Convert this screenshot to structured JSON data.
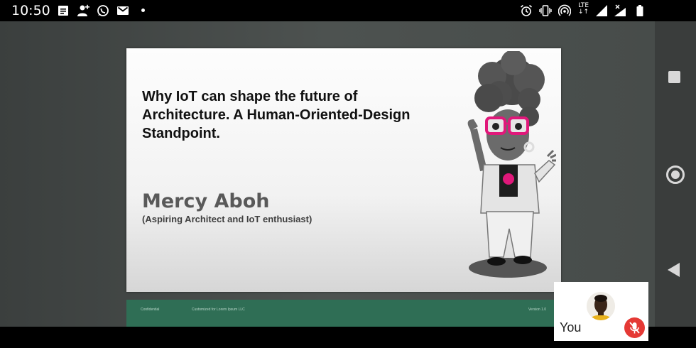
{
  "status_bar": {
    "time": "10:50",
    "notification_icons": [
      "message-icon",
      "add-person-icon",
      "whatsapp-icon",
      "gmail-icon",
      "more-dot-icon"
    ],
    "system_icons": [
      "alarm-icon",
      "vibrate-icon",
      "hotspot-icon",
      "lte-icon",
      "signal-icon",
      "signal-no-data-icon",
      "battery-icon"
    ],
    "network_label": "LTE"
  },
  "presentation": {
    "slide_title": "Why IoT can shape the future of Architecture. A Human-Oriented-Design Standpoint.",
    "presenter_name": "Mercy Aboh",
    "presenter_role": "(Aspiring Architect and IoT enthusiast)",
    "next_slide": {
      "left_text": "Confidential",
      "middle_text": "Customized for Lorem Ipsum LLC",
      "right_text": "Version 1.0"
    },
    "colors": {
      "next_slide_bg": "#2f6e55",
      "glasses": "#e0187a"
    }
  },
  "self_view": {
    "label": "You",
    "mic_state": "muted",
    "mic_color": "#e53935"
  },
  "nav_buttons": [
    "recents-button",
    "home-button",
    "back-button"
  ]
}
